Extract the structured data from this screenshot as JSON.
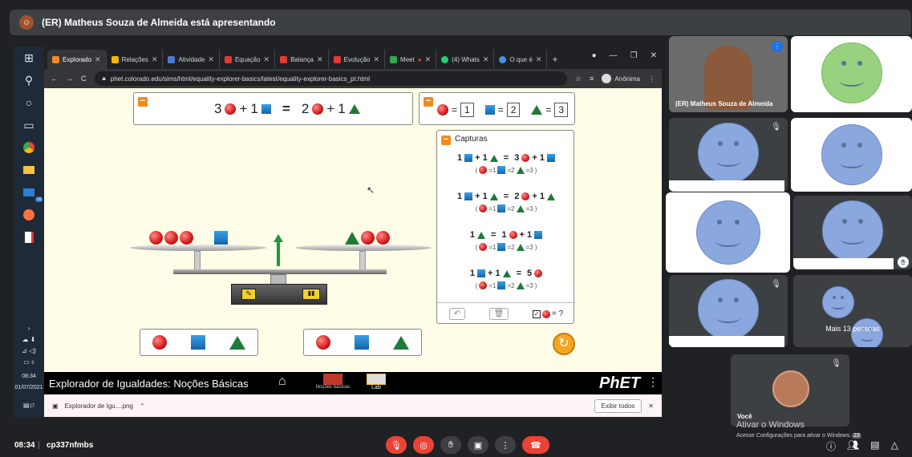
{
  "presenter_bar": {
    "text": "(ER) Matheus Souza de Almeida está apresentando"
  },
  "taskbar": {
    "time": "08:34",
    "date": "01/07/2021",
    "mail_badge": "16",
    "bottom_badge": "17"
  },
  "browser": {
    "tabs": [
      {
        "label": "Explorado",
        "color": "#f28a1d",
        "active": true
      },
      {
        "label": "Relações",
        "color": "#f2b705"
      },
      {
        "label": "Atividade",
        "color": "#4a7bd0"
      },
      {
        "label": "Equação",
        "color": "#e53935"
      },
      {
        "label": "Balança",
        "color": "#e53935"
      },
      {
        "label": "Evolução",
        "color": "#e53935"
      },
      {
        "label": "Meet",
        "color": "#34a853"
      },
      {
        "label": "(4) Whats",
        "color": "#25d366"
      },
      {
        "label": "O que é",
        "color": "#4a90e2"
      }
    ],
    "url": "phet.colorado.edu/sims/html/equality-explorer-basics/latest/equality-explorer-basics_pt.html",
    "incognito_label": "Anônima"
  },
  "phet": {
    "equation": {
      "left_ball": "3",
      "plus": "+",
      "left_box": "1",
      "equals": "=",
      "right_ball": "2",
      "right_tri": "1"
    },
    "values": {
      "ball": "1",
      "box": "2",
      "tri": "3"
    },
    "captures_title": "Capturas",
    "captures": [
      {
        "eq": [
          "1",
          "+ 1",
          "=",
          "3",
          "+ 1"
        ]
      },
      {
        "eq": [
          "1",
          "+ 1",
          "=",
          "2",
          "+ 1"
        ]
      },
      {
        "eq": [
          "1",
          "=",
          "1",
          "+ 1"
        ]
      },
      {
        "eq": [
          "1",
          "+ 1",
          "=",
          "5"
        ]
      }
    ],
    "capture_sub": {
      "ball": "=1",
      "box": "=2",
      "tri": "=3"
    },
    "capture_query": "= ?",
    "title": "Explorador de Igualdades: Noções Básicas",
    "screens": [
      {
        "label": "Noções básicas"
      },
      {
        "label": "Lab"
      }
    ],
    "brand": "PhET"
  },
  "download": {
    "file": "Explorador de Igu....png",
    "show_all": "Exibir todos"
  },
  "participants": {
    "presenter_name": "(ER) Matheus Souza de Almeida",
    "more_label": "Mais 13 pessoas",
    "you_label": "Você",
    "watermark_title": "Ativar o Windows",
    "watermark_sub": "Acesse Configurações para ativar o Windows.",
    "people_count": "23"
  },
  "meeting": {
    "time": "08:34",
    "code": "cp337nfmbs"
  }
}
